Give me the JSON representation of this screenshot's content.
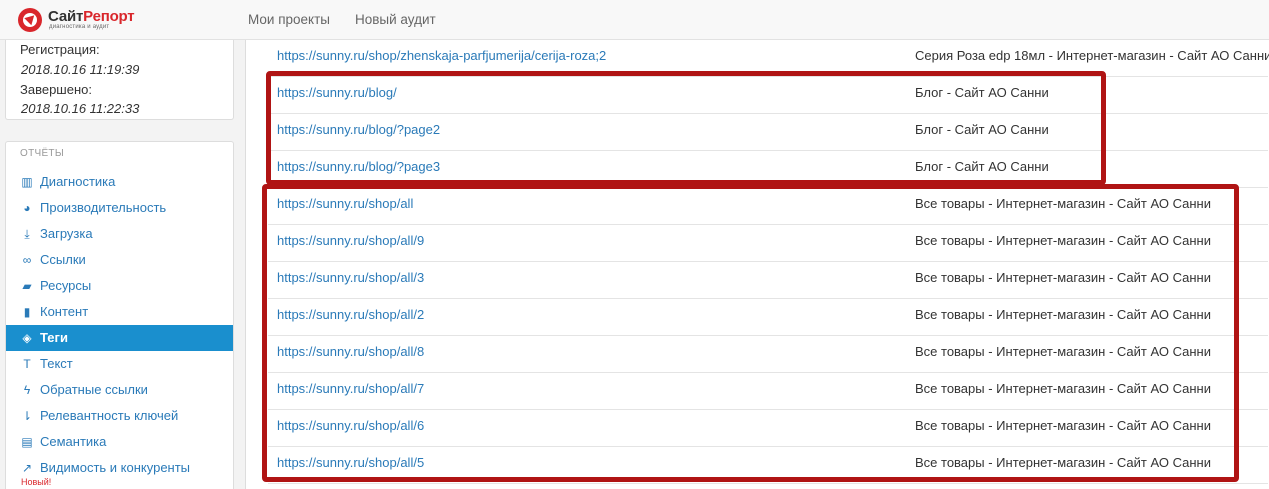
{
  "header": {
    "logo_name_a": "Сайт",
    "logo_name_b": "Репорт",
    "logo_tagline": "диагностика и аудит",
    "nav": [
      "Мои проекты",
      "Новый аудит"
    ]
  },
  "registration": {
    "reg_label": "Регистрация:",
    "reg_value": "2018.10.16 11:19:39",
    "done_label": "Завершено:",
    "done_value": "2018.10.16 11:22:33"
  },
  "sidebar": {
    "heading": "ОТЧЁТЫ",
    "items": [
      {
        "label": "Диагностика",
        "icon": "bar-chart-icon",
        "glyph": "▥"
      },
      {
        "label": "Производительность",
        "icon": "dashboard-icon",
        "glyph": "◕"
      },
      {
        "label": "Загрузка",
        "icon": "download-icon",
        "glyph": "⤓"
      },
      {
        "label": "Ссылки",
        "icon": "link-icon",
        "glyph": "∞"
      },
      {
        "label": "Ресурсы",
        "icon": "folder-open-icon",
        "glyph": "▰"
      },
      {
        "label": "Контент",
        "icon": "file-icon",
        "glyph": "▮"
      },
      {
        "label": "Теги",
        "icon": "tags-icon",
        "glyph": "◈"
      },
      {
        "label": "Текст",
        "icon": "text-icon",
        "glyph": "T"
      },
      {
        "label": "Обратные ссылки",
        "icon": "bolt-icon",
        "glyph": "ϟ"
      },
      {
        "label": "Релевантность ключей",
        "icon": "sort-icon",
        "glyph": "⇂"
      },
      {
        "label": "Семантика",
        "icon": "list-alt-icon",
        "glyph": "▤"
      },
      {
        "label": "Видимость и конкуренты",
        "icon": "line-chart-icon",
        "glyph": "↗"
      }
    ],
    "active_index": 6,
    "new_badge": "Новый!",
    "accent_color": "#1a8fce"
  },
  "table": {
    "rows": [
      {
        "url": "https://sunny.ru/shop/zhenskaja-parfjumerija/cerija-roza;2",
        "title": "Серия Роза edp 18мл - Интернет-магазин - Сайт АО Санни"
      },
      {
        "url": "https://sunny.ru/blog/",
        "title": "Блог - Сайт АО Санни"
      },
      {
        "url": "https://sunny.ru/blog/?page2",
        "title": "Блог - Сайт АО Санни"
      },
      {
        "url": "https://sunny.ru/blog/?page3",
        "title": "Блог - Сайт АО Санни"
      },
      {
        "url": "https://sunny.ru/shop/all",
        "title": "Все товары - Интернет-магазин - Сайт АО Санни"
      },
      {
        "url": "https://sunny.ru/shop/all/9",
        "title": "Все товары - Интернет-магазин - Сайт АО Санни"
      },
      {
        "url": "https://sunny.ru/shop/all/3",
        "title": "Все товары - Интернет-магазин - Сайт АО Санни"
      },
      {
        "url": "https://sunny.ru/shop/all/2",
        "title": "Все товары - Интернет-магазин - Сайт АО Санни"
      },
      {
        "url": "https://sunny.ru/shop/all/8",
        "title": "Все товары - Интернет-магазин - Сайт АО Санни"
      },
      {
        "url": "https://sunny.ru/shop/all/7",
        "title": "Все товары - Интернет-магазин - Сайт АО Санни"
      },
      {
        "url": "https://sunny.ru/shop/all/6",
        "title": "Все товары - Интернет-магазин - Сайт АО Санни"
      },
      {
        "url": "https://sunny.ru/shop/all/5",
        "title": "Все товары - Интернет-магазин - Сайт АО Санни"
      }
    ],
    "highlight_color": "#b01414"
  }
}
